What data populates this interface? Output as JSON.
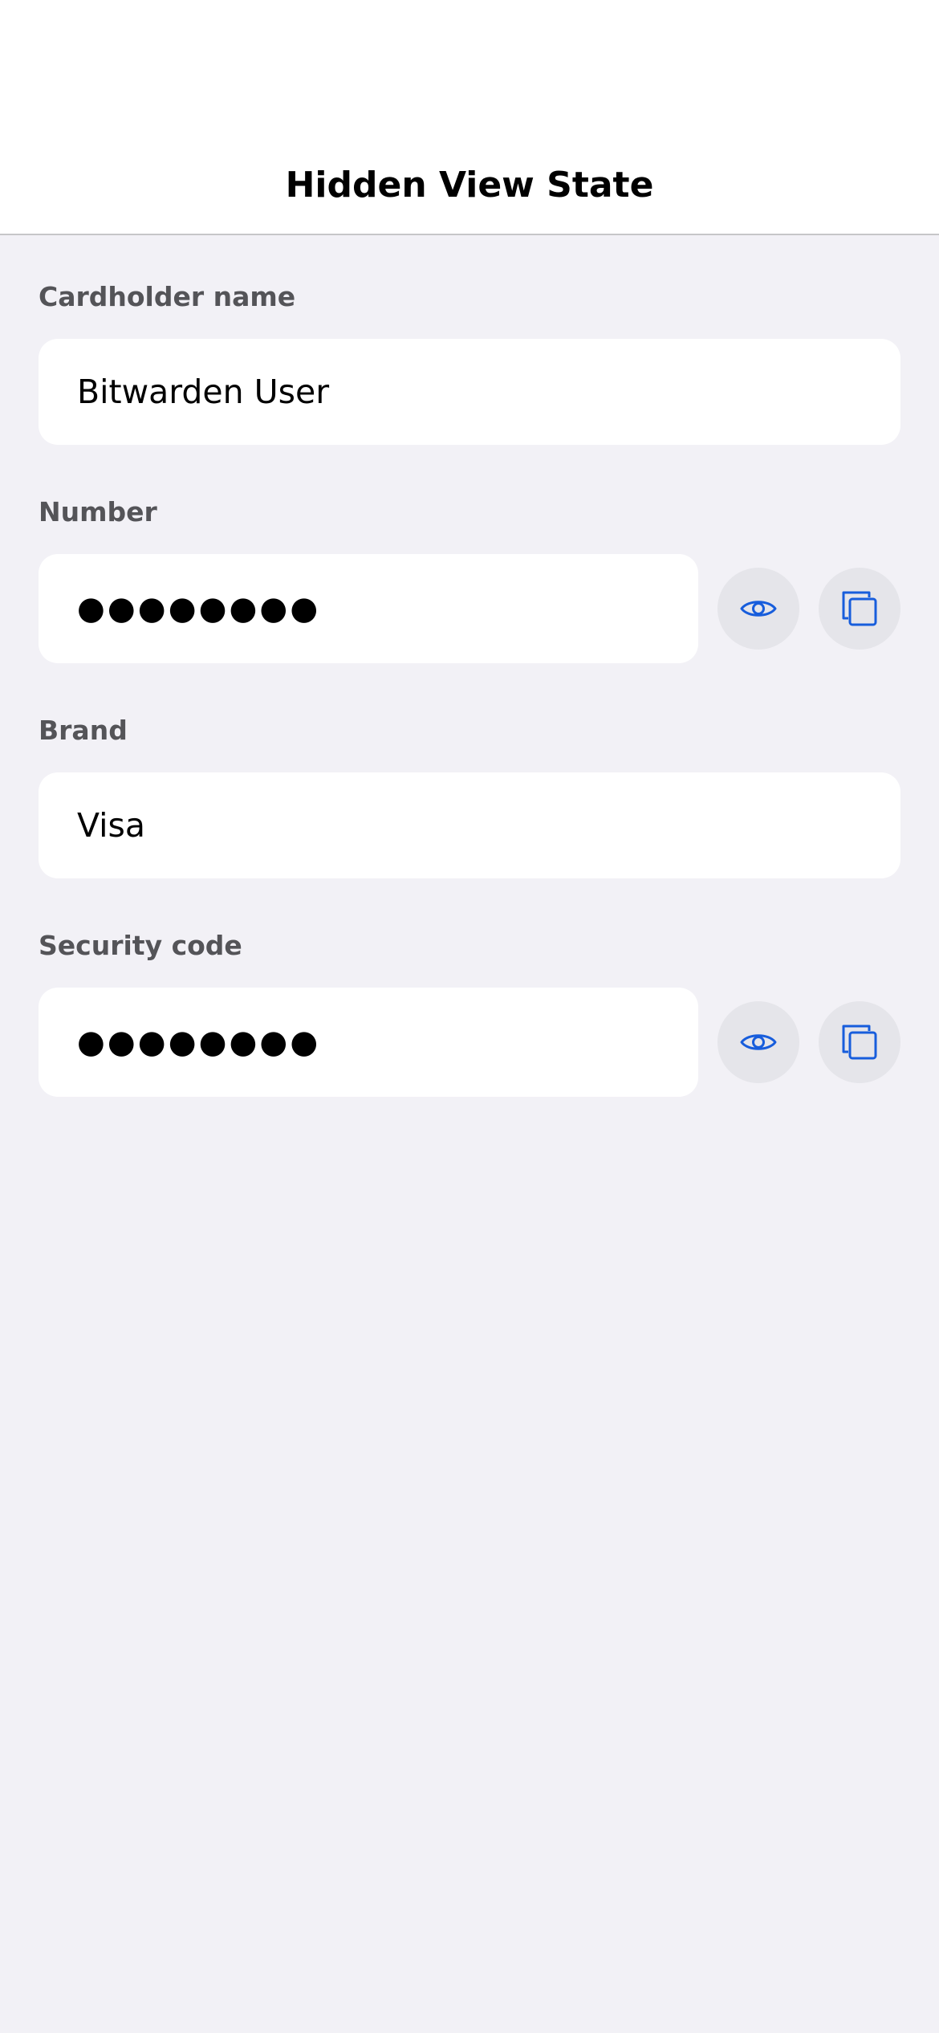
{
  "nav": {
    "title": "Hidden View State"
  },
  "fields": {
    "cardholder": {
      "label": "Cardholder name",
      "value": "Bitwarden User"
    },
    "number": {
      "label": "Number",
      "value": "●●●●●●●●",
      "reveal_icon": "eye-icon",
      "copy_icon": "copy-icon"
    },
    "brand": {
      "label": "Brand",
      "value": "Visa"
    },
    "security_code": {
      "label": "Security code",
      "value": "●●●●●●●●",
      "reveal_icon": "eye-icon",
      "copy_icon": "copy-icon"
    }
  },
  "colors": {
    "accent": "#175ddc",
    "background": "#f2f1f6",
    "field_background": "#ffffff",
    "button_background": "#e5e5ea",
    "label_text": "#545458"
  }
}
